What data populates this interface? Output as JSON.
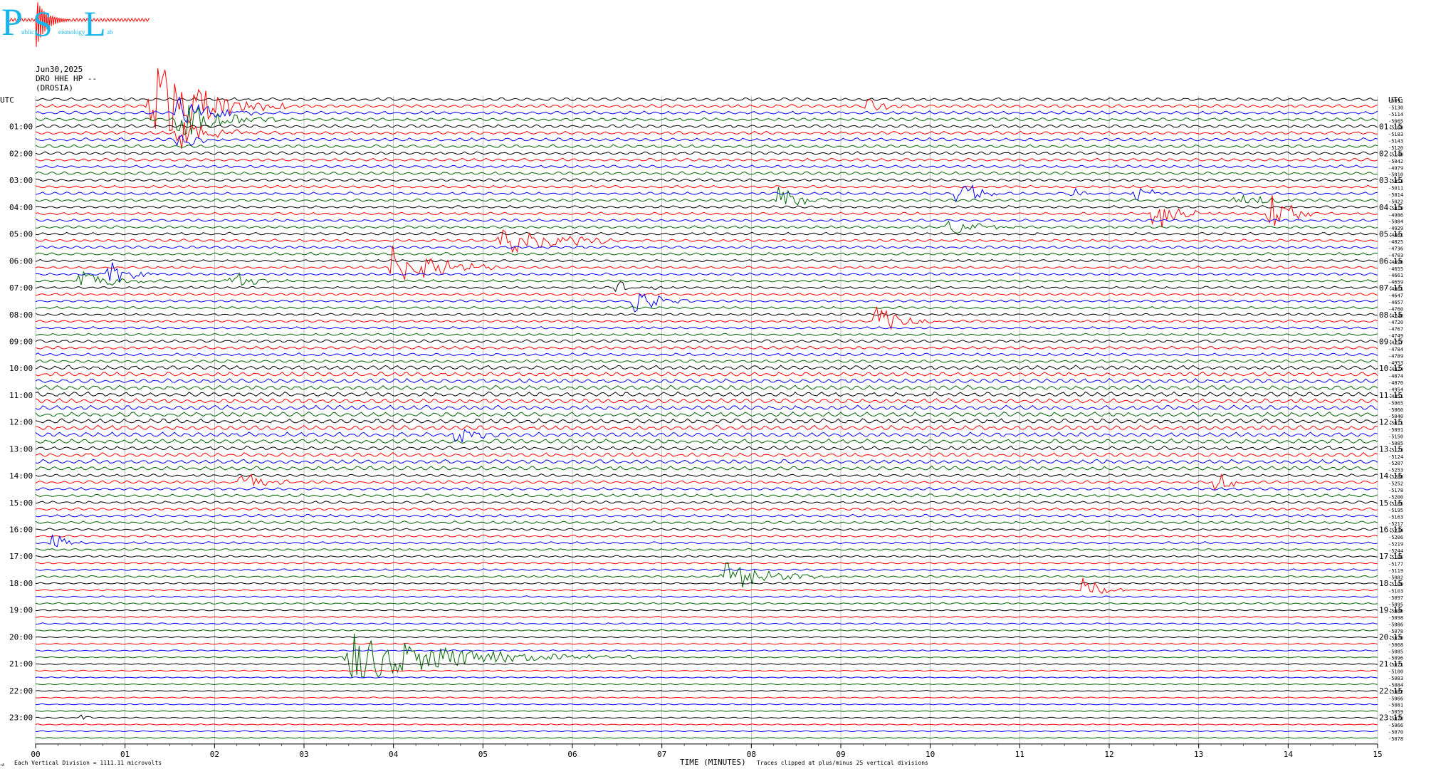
{
  "header": {
    "logo_letters": [
      "P",
      "S",
      "L"
    ],
    "logo_subtext_1": "ublic",
    "logo_subtext_2": "eismology",
    "logo_subtext_3": "ab",
    "date": "Jun30,2025",
    "station_line": "DRO HHE HP --",
    "station_name": "(DROSIA)"
  },
  "footer": {
    "scale_note": "Each Vertical Division = 1111.11 microvolts",
    "clip_note": "Traces clipped at plus/minus 25 vertical divisions",
    "corner_mark": "•A"
  },
  "colors": {
    "trace_cycle": [
      "#000000",
      "#ff0000",
      "#0000ff",
      "#006400"
    ],
    "logo": "#19b5ea",
    "grid": "#9a9a9a"
  },
  "chart_data": {
    "type": "line",
    "title": "",
    "xlabel": "TIME (MINUTES)",
    "x_range": [
      0,
      15
    ],
    "x_ticks": [
      "00",
      "01",
      "02",
      "03",
      "04",
      "05",
      "06",
      "07",
      "08",
      "09",
      "10",
      "11",
      "12",
      "13",
      "14",
      "15"
    ],
    "left_axis_title": "UTC",
    "right_axis_title": "UTC",
    "left_hour_labels": [
      "01:00",
      "02:00",
      "03:00",
      "04:00",
      "05:00",
      "06:00",
      "07:00",
      "08:00",
      "09:00",
      "10:00",
      "11:00",
      "12:00",
      "13:00",
      "14:00",
      "15:00",
      "16:00",
      "17:00",
      "18:00",
      "19:00",
      "20:00",
      "21:00",
      "22:00",
      "23:00"
    ],
    "right_hour_labels": [
      "01:15",
      "02:15",
      "03:15",
      "04:15",
      "05:15",
      "06:15",
      "07:15",
      "08:15",
      "09:15",
      "10:15",
      "11:15",
      "12:15",
      "13:15",
      "14:15",
      "15:15",
      "16:15",
      "17:15",
      "18:15",
      "19:15",
      "20:15",
      "21:15",
      "22:15",
      "23:15"
    ],
    "trace_count": 96,
    "trace_minutes": 15,
    "trace_offsets": [
      "-5091",
      "-5130",
      "-5114",
      "-5065",
      "-5169",
      "-5183",
      "-5143",
      "-5120",
      "-5140",
      "-5042",
      "-4979",
      "-5010",
      "-5053",
      "-5011",
      "-5014",
      "-5022",
      "-5019",
      "-4986",
      "-5084",
      "-4929",
      "-4861",
      "-4825",
      "-4736",
      "-4703",
      "-4696",
      "-4655",
      "-4661",
      "-4659",
      "-4661",
      "-4647",
      "-4657",
      "-4760",
      "-4740",
      "-4720",
      "-4767",
      "-4749",
      "-4757",
      "-4784",
      "-4789",
      "-4953",
      "-4924",
      "-4874",
      "-4870",
      "-4954",
      "-4951",
      "-5065",
      "-5060",
      "-5040",
      "-5011",
      "-5091",
      "-5150",
      "-5085",
      "-5123",
      "-5124",
      "-5207",
      "-5253",
      "-5288",
      "-5252",
      "-5178",
      "-5200",
      "-5185",
      "-5195",
      "-5163",
      "-5217",
      "-5234",
      "-5206",
      "-5219",
      "-5244",
      "-5186",
      "-5177",
      "-5119",
      "-5082",
      "-5109",
      "-5103",
      "-5097",
      "-5095",
      "-5086",
      "-5098",
      "-5086",
      "-5078",
      "-5070",
      "-5068",
      "-5085",
      "-5096",
      "-5071",
      "-5100",
      "-5083",
      "-5084",
      "-5082",
      "-5066",
      "-5081",
      "-5059",
      "-5078",
      "-5066",
      "-5070",
      "-5078"
    ],
    "noise_level_per_hour": [
      1.2,
      1.2,
      1.1,
      1.0,
      1.0,
      1.0,
      0.9,
      0.9,
      0.9,
      1.1,
      1.6,
      1.7,
      1.7,
      1.5,
      1.1,
      1.0,
      0.8,
      0.7,
      0.6,
      0.55,
      0.5,
      0.45,
      0.45,
      0.45
    ],
    "events": [
      {
        "trace": 1,
        "minute": 1.3,
        "duration_min": 1.5,
        "amplitude": 16
      },
      {
        "trace": 2,
        "minute": 1.6,
        "duration_min": 1.0,
        "amplitude": 6
      },
      {
        "trace": 3,
        "minute": 1.6,
        "duration_min": 1.2,
        "amplitude": 7
      },
      {
        "trace": 5,
        "minute": 1.6,
        "duration_min": 0.8,
        "amplitude": 6
      },
      {
        "trace": 6,
        "minute": 1.6,
        "duration_min": 0.5,
        "amplitude": 5
      },
      {
        "trace": 1,
        "minute": 9.3,
        "duration_min": 0.5,
        "amplitude": 3
      },
      {
        "trace": 15,
        "minute": 8.3,
        "duration_min": 0.6,
        "amplitude": 5
      },
      {
        "trace": 14,
        "minute": 10.3,
        "duration_min": 0.6,
        "amplitude": 6
      },
      {
        "trace": 14,
        "minute": 11.6,
        "duration_min": 0.2,
        "amplitude": 4
      },
      {
        "trace": 14,
        "minute": 12.3,
        "duration_min": 0.5,
        "amplitude": 3
      },
      {
        "trace": 17,
        "minute": 12.5,
        "duration_min": 0.6,
        "amplitude": 7
      },
      {
        "trace": 15,
        "minute": 13.4,
        "duration_min": 0.8,
        "amplitude": 3
      },
      {
        "trace": 17,
        "minute": 13.8,
        "duration_min": 0.6,
        "amplitude": 8
      },
      {
        "trace": 19,
        "minute": 10.2,
        "duration_min": 0.9,
        "amplitude": 3
      },
      {
        "trace": 21,
        "minute": 5.2,
        "duration_min": 1.6,
        "amplitude": 6
      },
      {
        "trace": 25,
        "minute": 4.0,
        "duration_min": 1.2,
        "amplitude": 9
      },
      {
        "trace": 26,
        "minute": 0.8,
        "duration_min": 0.6,
        "amplitude": 6
      },
      {
        "trace": 27,
        "minute": 0.5,
        "duration_min": 0.9,
        "amplitude": 4
      },
      {
        "trace": 27,
        "minute": 2.2,
        "duration_min": 0.5,
        "amplitude": 4
      },
      {
        "trace": 28,
        "minute": 6.5,
        "duration_min": 0.8,
        "amplitude": 2
      },
      {
        "trace": 30,
        "minute": 6.7,
        "duration_min": 0.8,
        "amplitude": 4
      },
      {
        "trace": 33,
        "minute": 9.4,
        "duration_min": 0.7,
        "amplitude": 5
      },
      {
        "trace": 50,
        "minute": 4.7,
        "duration_min": 0.6,
        "amplitude": 4
      },
      {
        "trace": 57,
        "minute": 2.3,
        "duration_min": 0.6,
        "amplitude": 5
      },
      {
        "trace": 57,
        "minute": 13.2,
        "duration_min": 0.4,
        "amplitude": 5
      },
      {
        "trace": 66,
        "minute": 0.2,
        "duration_min": 0.4,
        "amplitude": 4
      },
      {
        "trace": 71,
        "minute": 7.7,
        "duration_min": 1.2,
        "amplitude": 6
      },
      {
        "trace": 73,
        "minute": 11.7,
        "duration_min": 0.5,
        "amplitude": 5
      },
      {
        "trace": 83,
        "minute": 3.5,
        "duration_min": 3.2,
        "amplitude": 9
      },
      {
        "trace": 92,
        "minute": 0.5,
        "duration_min": 0.2,
        "amplitude": 2
      }
    ]
  }
}
